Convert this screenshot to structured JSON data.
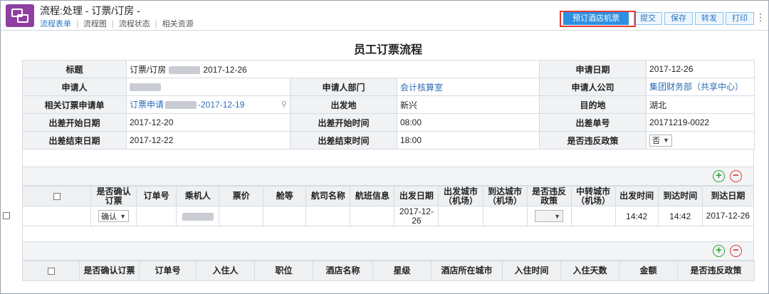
{
  "app": {
    "title": "流程:处理 - 订票/订房 -",
    "tabs": [
      "流程表单",
      "流程图",
      "流程状态",
      "相关资源"
    ],
    "active_tab": 0,
    "actions": {
      "book": "预订酒店机票",
      "submit": "提交",
      "save": "保存",
      "forward": "转发",
      "print": "打印"
    }
  },
  "form": {
    "title": "员工订票流程",
    "fields": {
      "title_label": "标题",
      "title_value": "订票/订房",
      "title_date": "2017-12-26",
      "apply_date_label": "申请日期",
      "apply_date": "2017-12-26",
      "applicant_label": "申请人",
      "dept_label": "申请人部门",
      "dept": "会计核算室",
      "company_label": "申请人公司",
      "company": "集团财务部（共享中心）",
      "related_label": "相关订票申请单",
      "related_prefix": "订票申请",
      "related_suffix": "-2017-12-19",
      "depart_label": "出发地",
      "depart": "新兴",
      "dest_label": "目的地",
      "dest": "湖北",
      "trip_start_date_label": "出差开始日期",
      "trip_start_date": "2017-12-20",
      "trip_start_time_label": "出差开始时间",
      "trip_start_time": "08:00",
      "trip_no_label": "出差单号",
      "trip_no": "20171219-0022",
      "trip_end_date_label": "出差结束日期",
      "trip_end_date": "2017-12-22",
      "trip_end_time_label": "出差结束时间",
      "trip_end_time": "18:00",
      "violate_label": "是否违反政策",
      "violate": "否"
    }
  },
  "flight_table": {
    "headers": [
      "是否确认订票",
      "订单号",
      "乘机人",
      "票价",
      "舱等",
      "航司名称",
      "航班信息",
      "出发日期",
      "出发城市（机场）",
      "到达城市（机场）",
      "是否违反政策",
      "中转城市（机场）",
      "出发时间",
      "到达时间",
      "到达日期"
    ],
    "row": {
      "confirm": "确认",
      "depart_date": "2017-12-26",
      "depart_time": "14:42",
      "arrive_time": "14:42",
      "arrive_date": "2017-12-26"
    }
  },
  "hotel_table": {
    "headers": [
      "是否确认订票",
      "订单号",
      "入住人",
      "职位",
      "酒店名称",
      "星级",
      "酒店所在城市",
      "入住时间",
      "入住天数",
      "金额",
      "是否违反政策"
    ]
  },
  "icons": {
    "logo": "workflow-logo-icon",
    "add": "plus-icon",
    "remove": "minus-icon",
    "search": "magnifier-icon",
    "more": "more-dots-icon"
  },
  "colors": {
    "logo": "#8e3fa0",
    "primary_button": "#2d8fe0",
    "highlight": "#e53935",
    "add": "#33a639",
    "remove": "#e23b3b",
    "link": "#2b6cb5"
  }
}
